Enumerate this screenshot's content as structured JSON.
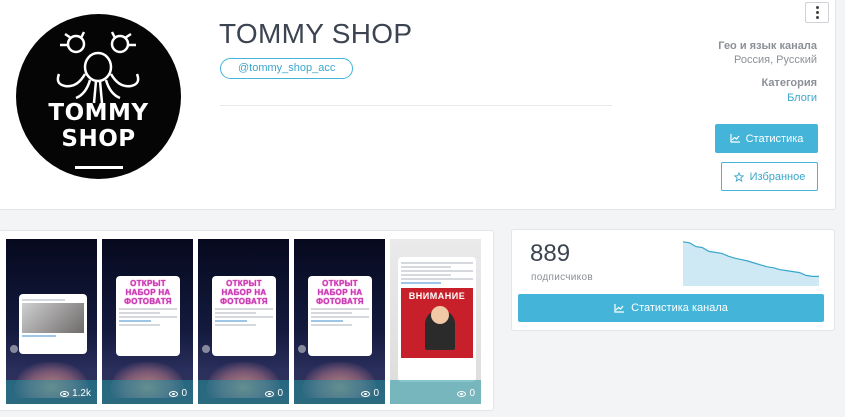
{
  "channel": {
    "title": "TOMMY SHOP",
    "handle": "@tommy_shop_acc",
    "logo_line1": "TOMMY",
    "logo_line2": "SHOP"
  },
  "meta": {
    "geo_label": "Гео и язык канала",
    "geo_value": "Россия, Русский",
    "category_label": "Категория",
    "category_value": "Блоги"
  },
  "buttons": {
    "stats": "Статистика",
    "favorite": "Избранное",
    "channel_stats": "Статистика канала"
  },
  "subscribers": {
    "count": "889",
    "label": "подписчиков",
    "trend": [
      0.92,
      0.9,
      0.82,
      0.8,
      0.72,
      0.7,
      0.68,
      0.62,
      0.58,
      0.55,
      0.52,
      0.48,
      0.44,
      0.4,
      0.38,
      0.34,
      0.32,
      0.3,
      0.28,
      0.22,
      0.2,
      0.2
    ]
  },
  "posts": [
    {
      "views": "1.2k",
      "promo": ""
    },
    {
      "views": "0",
      "promo": "ОТКРЫТ НАБОР НА ФОТОВАТЯ"
    },
    {
      "views": "0",
      "promo": "ОТКРЫТ НАБОР НА ФОТОВАТЯ"
    },
    {
      "views": "0",
      "promo": "ОТКРЫТ НАБОР НА ФОТОВАТЯ"
    },
    {
      "views": "0",
      "promo": "ВНИМАНИЕ"
    }
  ],
  "colors": {
    "accent": "#44b5d9",
    "text": "#3d4451",
    "muted": "#8b9096",
    "promo": "#c03fb4"
  }
}
